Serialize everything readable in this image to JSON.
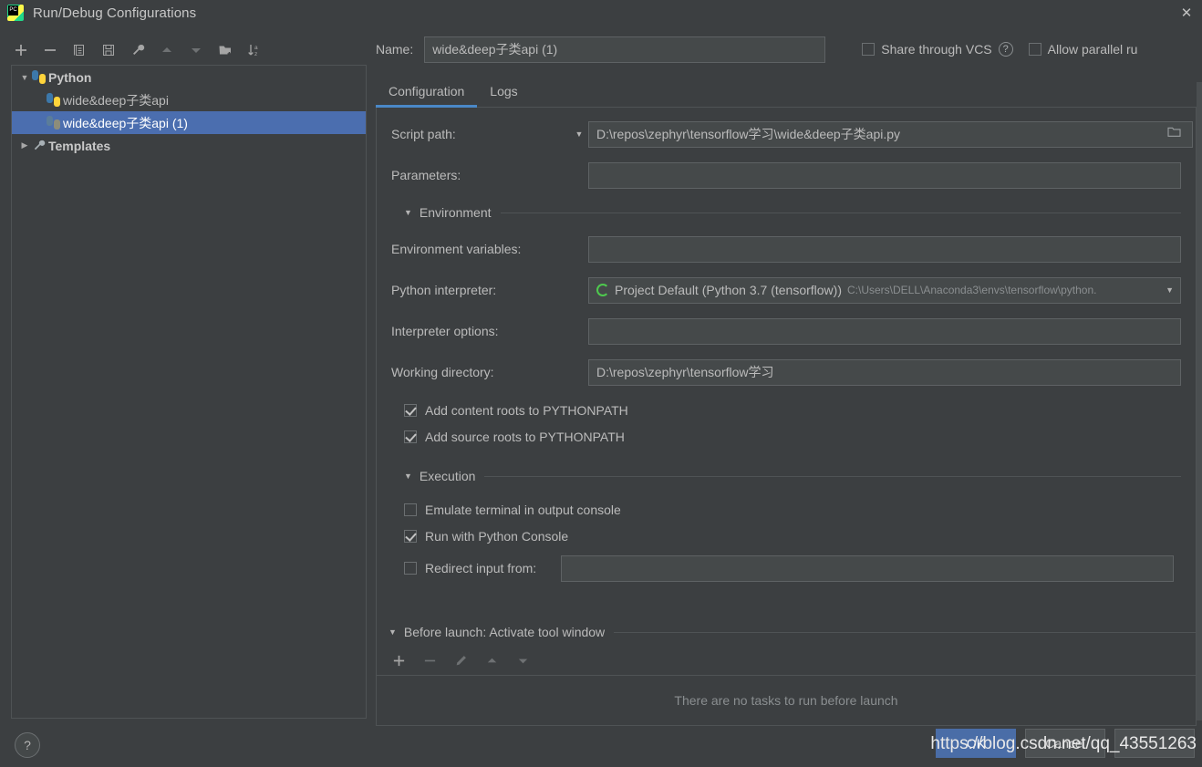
{
  "window": {
    "title": "Run/Debug Configurations",
    "app_icon": "pycharm-icon",
    "close_icon": "close-icon"
  },
  "left_toolbar": {
    "items": [
      {
        "name": "add-configuration-button",
        "icon": "plus-icon",
        "enabled": true
      },
      {
        "name": "remove-configuration-button",
        "icon": "minus-icon",
        "enabled": true
      },
      {
        "name": "copy-configuration-button",
        "icon": "copy-icon",
        "enabled": true
      },
      {
        "name": "save-configuration-button",
        "icon": "save-icon",
        "enabled": true
      },
      {
        "name": "edit-templates-button",
        "icon": "wrench-icon",
        "enabled": true
      },
      {
        "name": "move-up-button",
        "icon": "arrow-up-icon",
        "enabled": false
      },
      {
        "name": "move-down-button",
        "icon": "arrow-down-icon",
        "enabled": false
      },
      {
        "name": "new-folder-button",
        "icon": "folder-add-icon",
        "enabled": true
      },
      {
        "name": "sort-alphabetically-button",
        "icon": "sort-az-icon",
        "enabled": true
      }
    ]
  },
  "tree": {
    "nodes": [
      {
        "label": "Python",
        "level": 0,
        "expanded": true,
        "icon": "python-icon",
        "selected": false,
        "bold": true
      },
      {
        "label": "wide&deep子类api",
        "level": 1,
        "expanded": null,
        "icon": "python-icon",
        "selected": false,
        "bold": false
      },
      {
        "label": "wide&deep子类api (1)",
        "level": 1,
        "expanded": null,
        "icon": "python-grey-icon",
        "selected": true,
        "bold": false
      },
      {
        "label": "Templates",
        "level": 0,
        "expanded": false,
        "icon": "wrench-icon",
        "selected": false,
        "bold": true
      }
    ]
  },
  "header": {
    "name_label": "Name:",
    "name_value": "wide&deep子类api (1)",
    "share_vcs_label": "Share through VCS",
    "share_vcs_checked": false,
    "share_vcs_help_icon": "question-mark-icon",
    "allow_parallel_label": "Allow parallel ru",
    "allow_parallel_checked": false
  },
  "tabs": [
    {
      "label": "Configuration",
      "active": true
    },
    {
      "label": "Logs",
      "active": false
    }
  ],
  "configuration": {
    "script_path_label": "Script path:",
    "script_path_value": "D:\\repos\\zephyr\\tensorflow学习\\wide&deep子类api.py",
    "parameters_label": "Parameters:",
    "parameters_value": "",
    "environment_section": "Environment",
    "environment_variables_label": "Environment variables:",
    "environment_variables_value": "",
    "python_interpreter_label": "Python interpreter:",
    "python_interpreter_value": "Project Default (Python 3.7 (tensorflow))",
    "python_interpreter_path": "C:\\Users\\DELL\\Anaconda3\\envs\\tensorflow\\python.",
    "interpreter_options_label": "Interpreter options:",
    "interpreter_options_value": "",
    "working_directory_label": "Working directory:",
    "working_directory_value": "D:\\repos\\zephyr\\tensorflow学习",
    "add_content_roots_label": "Add content roots to PYTHONPATH",
    "add_content_roots_checked": true,
    "add_source_roots_label": "Add source roots to PYTHONPATH",
    "add_source_roots_checked": true,
    "execution_section": "Execution",
    "emulate_terminal_label": "Emulate terminal in output console",
    "emulate_terminal_checked": false,
    "run_with_console_label": "Run with Python Console",
    "run_with_console_checked": true,
    "redirect_input_label": "Redirect input from:",
    "redirect_input_checked": false,
    "redirect_input_value": ""
  },
  "before_launch": {
    "title": "Before launch: Activate tool window",
    "toolbar": [
      {
        "name": "add-task-button",
        "icon": "plus-icon",
        "enabled": true
      },
      {
        "name": "remove-task-button",
        "icon": "minus-icon",
        "enabled": false
      },
      {
        "name": "edit-task-button",
        "icon": "pencil-icon",
        "enabled": false
      },
      {
        "name": "task-move-up-button",
        "icon": "arrow-up-icon",
        "enabled": false
      },
      {
        "name": "task-move-down-button",
        "icon": "arrow-down-icon",
        "enabled": false
      }
    ],
    "empty_text": "There are no tasks to run before launch"
  },
  "footer": {
    "help_icon": "question-mark-icon",
    "ok_label": "OK",
    "cancel_label": "Cancel",
    "apply_label": "",
    "watermark": "https://blog.csdn.net/qq_43551263"
  },
  "colors": {
    "background": "#3c3f41",
    "field_background": "#45494a",
    "selection": "#4b6eaf",
    "accent": "#4a88c7",
    "primary_button": "#4a6da7",
    "text": "#bbbbbb",
    "muted_text": "#8a8e90"
  }
}
